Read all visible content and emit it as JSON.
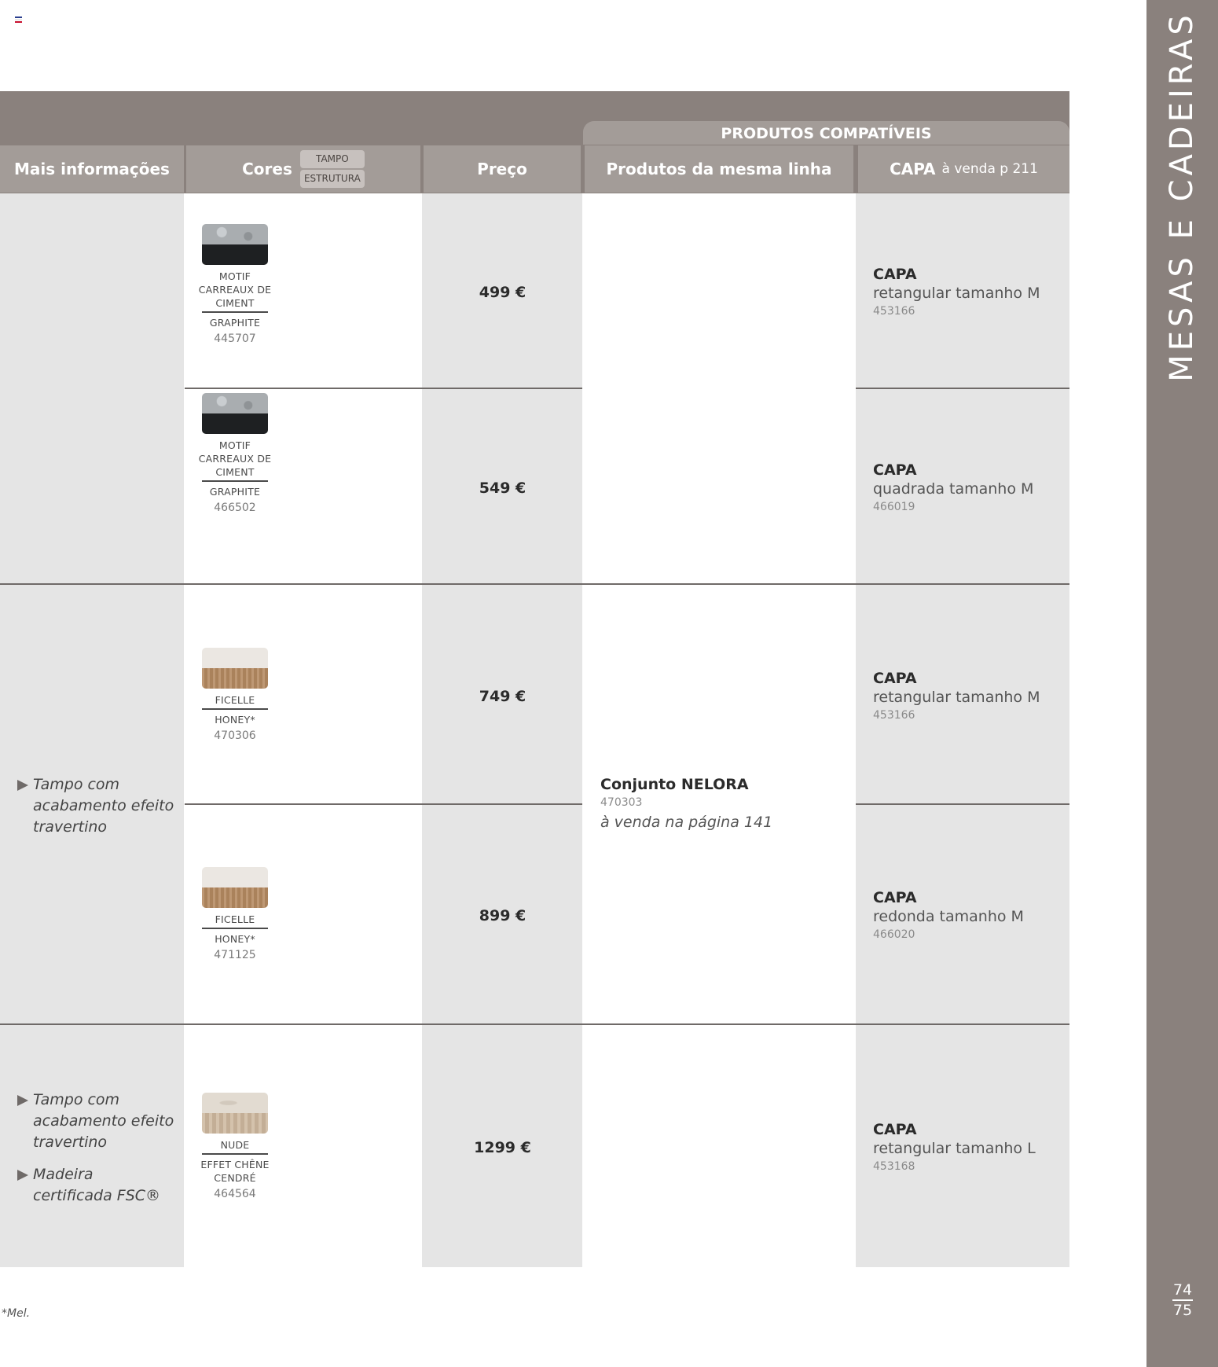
{
  "header": {
    "compat_title": "PRODUTOS COMPATÍVEIS",
    "col_info": "Mais informações",
    "col_cores": "Cores",
    "pill_tampo": "TAMPO",
    "pill_estrutura": "ESTRUTURA",
    "col_preco": "Preço",
    "col_linha": "Produtos  da mesma linha",
    "col_capa": "CAPA",
    "col_capa_note": "à venda p 211"
  },
  "rows": [
    {
      "swatch": {
        "top_line1": "MOTIF",
        "top_line2": "CARREAUX DE",
        "top_line3": "CIMENT",
        "bottom": "GRAPHITE",
        "ref": "445707",
        "top_color": "#a9adb0",
        "bottom_color": "#1e2022"
      },
      "price": "499 €",
      "capa": {
        "title": "CAPA",
        "desc": "retangular tamanho M",
        "ref": "453166"
      }
    },
    {
      "swatch": {
        "top_line1": "MOTIF",
        "top_line2": "CARREAUX DE",
        "top_line3": "CIMENT",
        "bottom": "GRAPHITE",
        "ref": "466502",
        "top_color": "#a9adb0",
        "bottom_color": "#1e2022"
      },
      "price": "549 €",
      "capa": {
        "title": "CAPA",
        "desc": "quadrada tamanho M",
        "ref": "466019"
      }
    },
    {
      "swatch": {
        "top_line1": "FICELLE",
        "bottom": "HONEY*",
        "ref": "470306",
        "top_color": "#ebe7e2",
        "bottom_color": "#b58a61"
      },
      "price": "749 €",
      "capa": {
        "title": "CAPA",
        "desc": "retangular tamanho M",
        "ref": "453166"
      }
    },
    {
      "swatch": {
        "top_line1": "FICELLE",
        "bottom": "HONEY*",
        "ref": "471125",
        "top_color": "#ebe7e2",
        "bottom_color": "#b58a61"
      },
      "price": "899 €",
      "capa": {
        "title": "CAPA",
        "desc": "redonda tamanho M",
        "ref": "466020"
      }
    },
    {
      "swatch": {
        "top_line1": "NUDE",
        "bottom_line1": "EFFET CHÊNE",
        "bottom_line2": "CENDRÉ",
        "ref": "464564",
        "top_color": "#e2dbd1",
        "bottom_color": "#cdb79e"
      },
      "price": "1299 €",
      "capa": {
        "title": "CAPA",
        "desc": "retangular tamanho L",
        "ref": "453168"
      }
    }
  ],
  "info": {
    "group2": [
      "Tampo com acabamento efeito travertino"
    ],
    "group3": [
      "Tampo com acabamento efeito travertino",
      "Madeira certificada FSC®"
    ]
  },
  "conjunto": {
    "title": "Conjunto NELORA",
    "ref": "470303",
    "note": "à venda na página 141"
  },
  "footnote": "*Mel.",
  "sidebar": {
    "title": "MESAS E CADEIRAS",
    "page_top": "74",
    "page_bottom": "75"
  },
  "colors": {
    "header_dark": "#8a817d",
    "header_light": "#a39c98",
    "column_shade": "#e5e5e5"
  }
}
